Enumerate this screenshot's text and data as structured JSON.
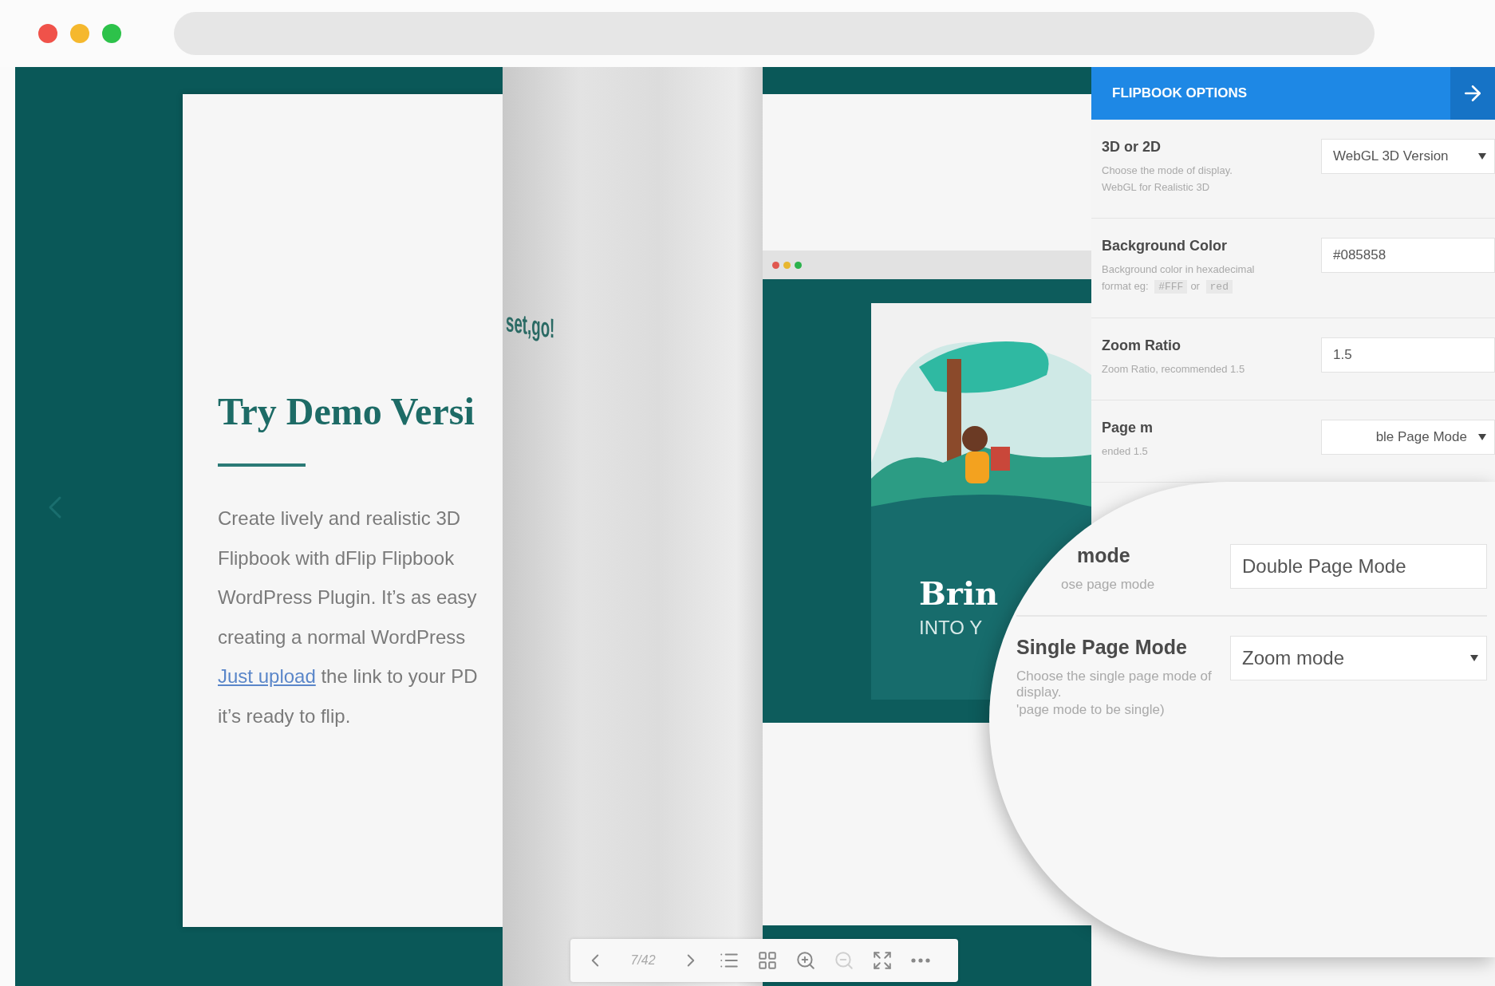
{
  "browser": {
    "dots": [
      {
        "color": "#f0524a"
      },
      {
        "color": "#f5b82e"
      },
      {
        "color": "#2dc24a"
      }
    ]
  },
  "left_page": {
    "title": "Try Demo Versi",
    "lines": [
      "Create lively and realistic 3D",
      "Flipbook with dFlip Flipbook",
      "WordPress Plugin. It’s as easy",
      "creating a normal WordPress"
    ],
    "link": "Just upload",
    "link_rest": "the link to your PD",
    "last_line": "it’s ready to flip."
  },
  "curl_page": {
    "text": "set,go!"
  },
  "right_page": {
    "dots": [
      {
        "color": "#e0574f"
      },
      {
        "color": "#e8b730"
      },
      {
        "color": "#2bb24c"
      }
    ],
    "cover_title": "Brin",
    "cover_subtitle": "INTO Y"
  },
  "options": {
    "title": "FLIPBOOK OPTIONS",
    "rows": [
      {
        "label": "3D or 2D",
        "desc": [
          {
            "kind": "plain",
            "text": "Choose the mode of display. WebGL for Realistic 3D"
          }
        ],
        "kind": "select",
        "value": "WebGL 3D Version"
      },
      {
        "label": "Background Color",
        "desc": [
          {
            "kind": "plain",
            "text": "Background color in hexadecimal format eg:"
          },
          {
            "kind": "code",
            "text": "#FFF"
          },
          {
            "kind": "plain",
            "text": "or"
          },
          {
            "kind": "code",
            "text": "red"
          }
        ],
        "kind": "input",
        "value": "#085858"
      },
      {
        "label": "Zoom Ratio",
        "desc": [
          {
            "kind": "plain",
            "text": "Zoom Ratio, recommended 1.5"
          }
        ],
        "kind": "input",
        "value": "1.5"
      },
      {
        "label": "Page m",
        "desc": [
          {
            "kind": "plain",
            "text": "ended 1.5"
          }
        ],
        "kind": "select",
        "value": "ble Page Mode"
      }
    ]
  },
  "magnifier": {
    "rows": [
      {
        "label": "mode",
        "desc": [
          "ose page mode"
        ],
        "kind": "plain",
        "value": "Double Page Mode"
      },
      {
        "label": "Single Page Mode",
        "desc": [
          "Choose the single page mode of display.",
          "'page mode to be single)"
        ],
        "kind": "select",
        "value": "Zoom mode"
      }
    ]
  },
  "toolbar": {
    "page": "7/42",
    "buttons": [
      {
        "kind": "prev",
        "disabled": false
      },
      {
        "kind": "next",
        "disabled": false
      },
      {
        "kind": "list",
        "disabled": false
      },
      {
        "kind": "grid",
        "disabled": false
      },
      {
        "kind": "zoom_in",
        "disabled": false
      },
      {
        "kind": "zoom_out",
        "disabled": true
      },
      {
        "kind": "fullscreen",
        "disabled": false
      },
      {
        "kind": "more",
        "disabled": false
      }
    ]
  }
}
